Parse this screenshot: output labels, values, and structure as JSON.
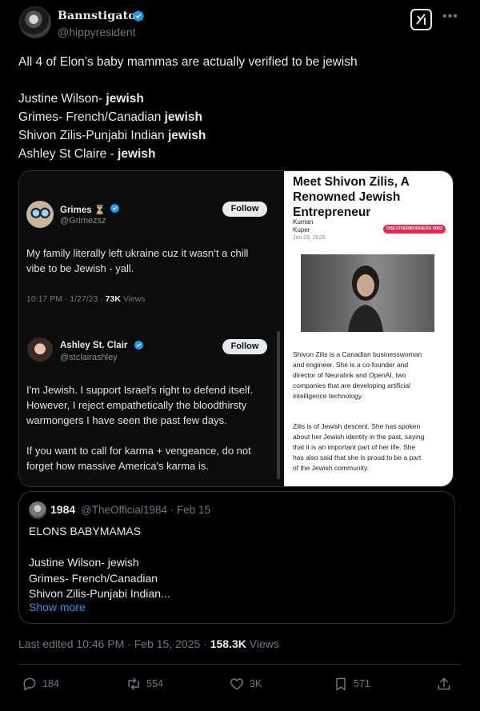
{
  "author": {
    "display_name": "Bannstigator",
    "handle": "@hippyresident",
    "avatar_icon": "avatar-image",
    "verified_color": "#1d9bf0"
  },
  "tweet": {
    "lines": [
      {
        "plain": "All 4 of Elon’s baby mammas are actually verified to be jewish",
        "bold": ""
      },
      {
        "plain": "",
        "bold": ""
      },
      {
        "plain": "Justine Wilson- ",
        "bold": "jewish"
      },
      {
        "plain": "Grimes- French/Canadian ",
        "bold": "jewish"
      },
      {
        "plain": "Shivon Zilis-Punjabi Indian ",
        "bold": "jewish"
      },
      {
        "plain": "Ashley St Claire - ",
        "bold": "jewish"
      }
    ]
  },
  "media": {
    "grimes_post": {
      "name": "Grimes",
      "emoji": "⏳",
      "handle": "@Grimezsz",
      "follow_label": "Follow",
      "body": [
        "My family literally left ukraine cuz it wasn’t a chill",
        "vibe to be Jewish - yall."
      ],
      "time": "10:17 PM · 1/27/23 · ",
      "views_count": "73K",
      "views_label": " Views"
    },
    "ashley_post": {
      "name": "Ashley St. Clair",
      "handle": "@stclairashley",
      "follow_label": "Follow",
      "body": [
        "I'm Jewish. I support Israel's right to defend itself.",
        "However, I reject empathetically the bloodthirsty",
        "warmongers I have seen the past few days.",
        "",
        "If you want to call for karma + vengeance, do not",
        "forget how massive America's karma is."
      ]
    },
    "article": {
      "title": [
        "Meet Shivon Zilis, A",
        "Renowned Jewish",
        "Entrepreneur"
      ],
      "author": [
        "Kuman",
        "Kuper"
      ],
      "date": "Jan 29, 2025",
      "badge": "DISCOVERBORDERS 0002",
      "badge_color": "#e8294d",
      "paragraph1": [
        "Shivon Zilis is a Canadian businesswoman",
        "and engineer. She is a co-founder and",
        "director of Neuralink and OpenAI, two",
        "companies that are developing artificial",
        "intelligence technology."
      ],
      "paragraph2": [
        "Zilis is of Jewish descent. She has spoken",
        "about her Jewish identity in the past, saying",
        "that it is an important part of her life. She",
        "has also said that she is proud to be a part",
        "of the Jewish community."
      ]
    }
  },
  "quote": {
    "name": "1984",
    "meta": "@TheOfficial1984 · Feb 15",
    "lines": [
      "ELONS BABYMAMAS",
      "",
      "Justine Wilson- jewish",
      "Grimes- French/Canadian",
      "Shivon Zilis-Punjabi Indian..."
    ],
    "show_more": "Show more"
  },
  "footer": {
    "edited": "Last edited 10:46 PM · Feb 15, 2025 · ",
    "views_count": "158.3K",
    "views_label": " Views"
  },
  "actions": {
    "replies": "184",
    "reposts": "554",
    "likes": "3K",
    "bookmarks": "571"
  },
  "colors": {
    "background": "#000000",
    "text": "#e7e9ea",
    "muted": "#71767b",
    "border": "#2f3336",
    "link": "#1d9bf0"
  }
}
